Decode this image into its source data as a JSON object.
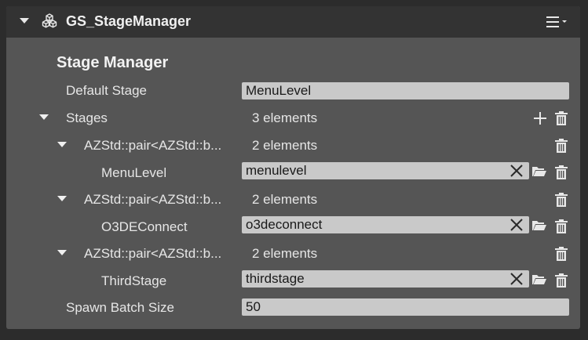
{
  "component": {
    "title": "GS_StageManager",
    "icon": "cubes-icon",
    "menu_icon": "hamburger-menu-icon"
  },
  "section": {
    "title": "Stage Manager"
  },
  "default_stage": {
    "label": "Default Stage",
    "value": "MenuLevel"
  },
  "stages": {
    "label": "Stages",
    "count": "3 elements",
    "items": [
      {
        "pair_label": "AZStd::pair<AZStd::b...",
        "count": "2 elements",
        "name": "MenuLevel",
        "value": "menulevel"
      },
      {
        "pair_label": "AZStd::pair<AZStd::b...",
        "count": "2 elements",
        "name": "O3DEConnect",
        "value": "o3deconnect"
      },
      {
        "pair_label": "AZStd::pair<AZStd::b...",
        "count": "2 elements",
        "name": "ThirdStage",
        "value": "thirdstage"
      }
    ]
  },
  "spawn_batch_size": {
    "label": "Spawn Batch Size",
    "value": "50"
  },
  "colors": {
    "panel": "#555555",
    "header": "#333333",
    "field": "#c9c9c9",
    "text": "#e6e6e6"
  }
}
